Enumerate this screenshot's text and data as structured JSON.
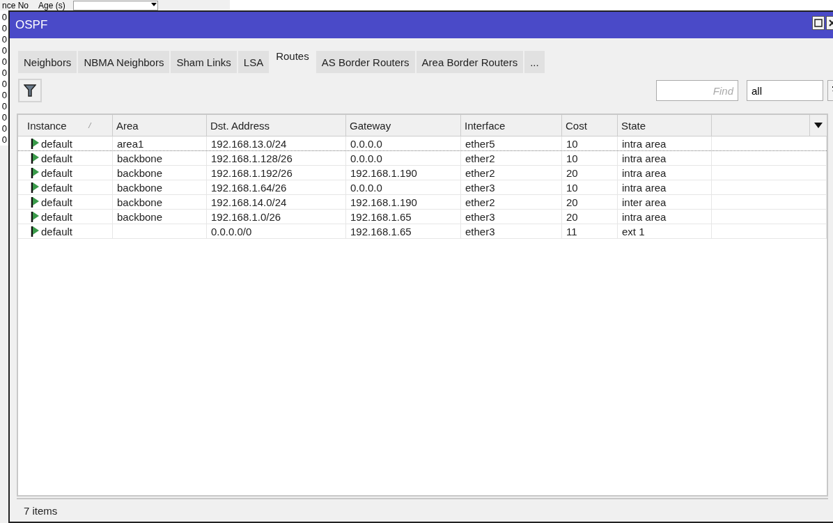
{
  "background_window": {
    "columns": [
      "nce No",
      "Age (s)"
    ],
    "rows": [
      "0",
      "0",
      "0",
      "0",
      "0",
      "0",
      "0",
      "0",
      "0",
      "0",
      "0",
      "0"
    ]
  },
  "window": {
    "title": "OSPF"
  },
  "tabs": [
    {
      "label": "Neighbors",
      "selected": false
    },
    {
      "label": "NBMA Neighbors",
      "selected": false
    },
    {
      "label": "Sham Links",
      "selected": false
    },
    {
      "label": "LSA",
      "selected": false
    },
    {
      "label": "Routes",
      "selected": true
    },
    {
      "label": "AS Border Routers",
      "selected": false
    },
    {
      "label": "Area Border Routers",
      "selected": false
    },
    {
      "label": "...",
      "selected": false
    }
  ],
  "toolbar": {
    "find": {
      "placeholder": "Find"
    },
    "filter": {
      "value": "all"
    }
  },
  "table": {
    "columns": [
      "Instance",
      "Area",
      "Dst. Address",
      "Gateway",
      "Interface",
      "Cost",
      "State"
    ],
    "rows": [
      {
        "selected": true,
        "cells": [
          "default",
          "area1",
          "192.168.13.0/24",
          "0.0.0.0",
          "ether5",
          "10",
          "intra area"
        ]
      },
      {
        "selected": false,
        "cells": [
          "default",
          "backbone",
          "192.168.1.128/26",
          "0.0.0.0",
          "ether2",
          "10",
          "intra area"
        ]
      },
      {
        "selected": false,
        "cells": [
          "default",
          "backbone",
          "192.168.1.192/26",
          "192.168.1.190",
          "ether2",
          "20",
          "intra area"
        ]
      },
      {
        "selected": false,
        "cells": [
          "default",
          "backbone",
          "192.168.1.64/26",
          "0.0.0.0",
          "ether3",
          "10",
          "intra area"
        ]
      },
      {
        "selected": false,
        "cells": [
          "default",
          "backbone",
          "192.168.14.0/24",
          "192.168.1.190",
          "ether2",
          "20",
          "inter area"
        ]
      },
      {
        "selected": false,
        "cells": [
          "default",
          "backbone",
          "192.168.1.0/26",
          "192.168.1.65",
          "ether3",
          "20",
          "intra area"
        ]
      },
      {
        "selected": false,
        "cells": [
          "default",
          "",
          "0.0.0.0/0",
          "192.168.1.65",
          "ether3",
          "11",
          "ext 1"
        ]
      }
    ]
  },
  "status_bar": "7 items"
}
